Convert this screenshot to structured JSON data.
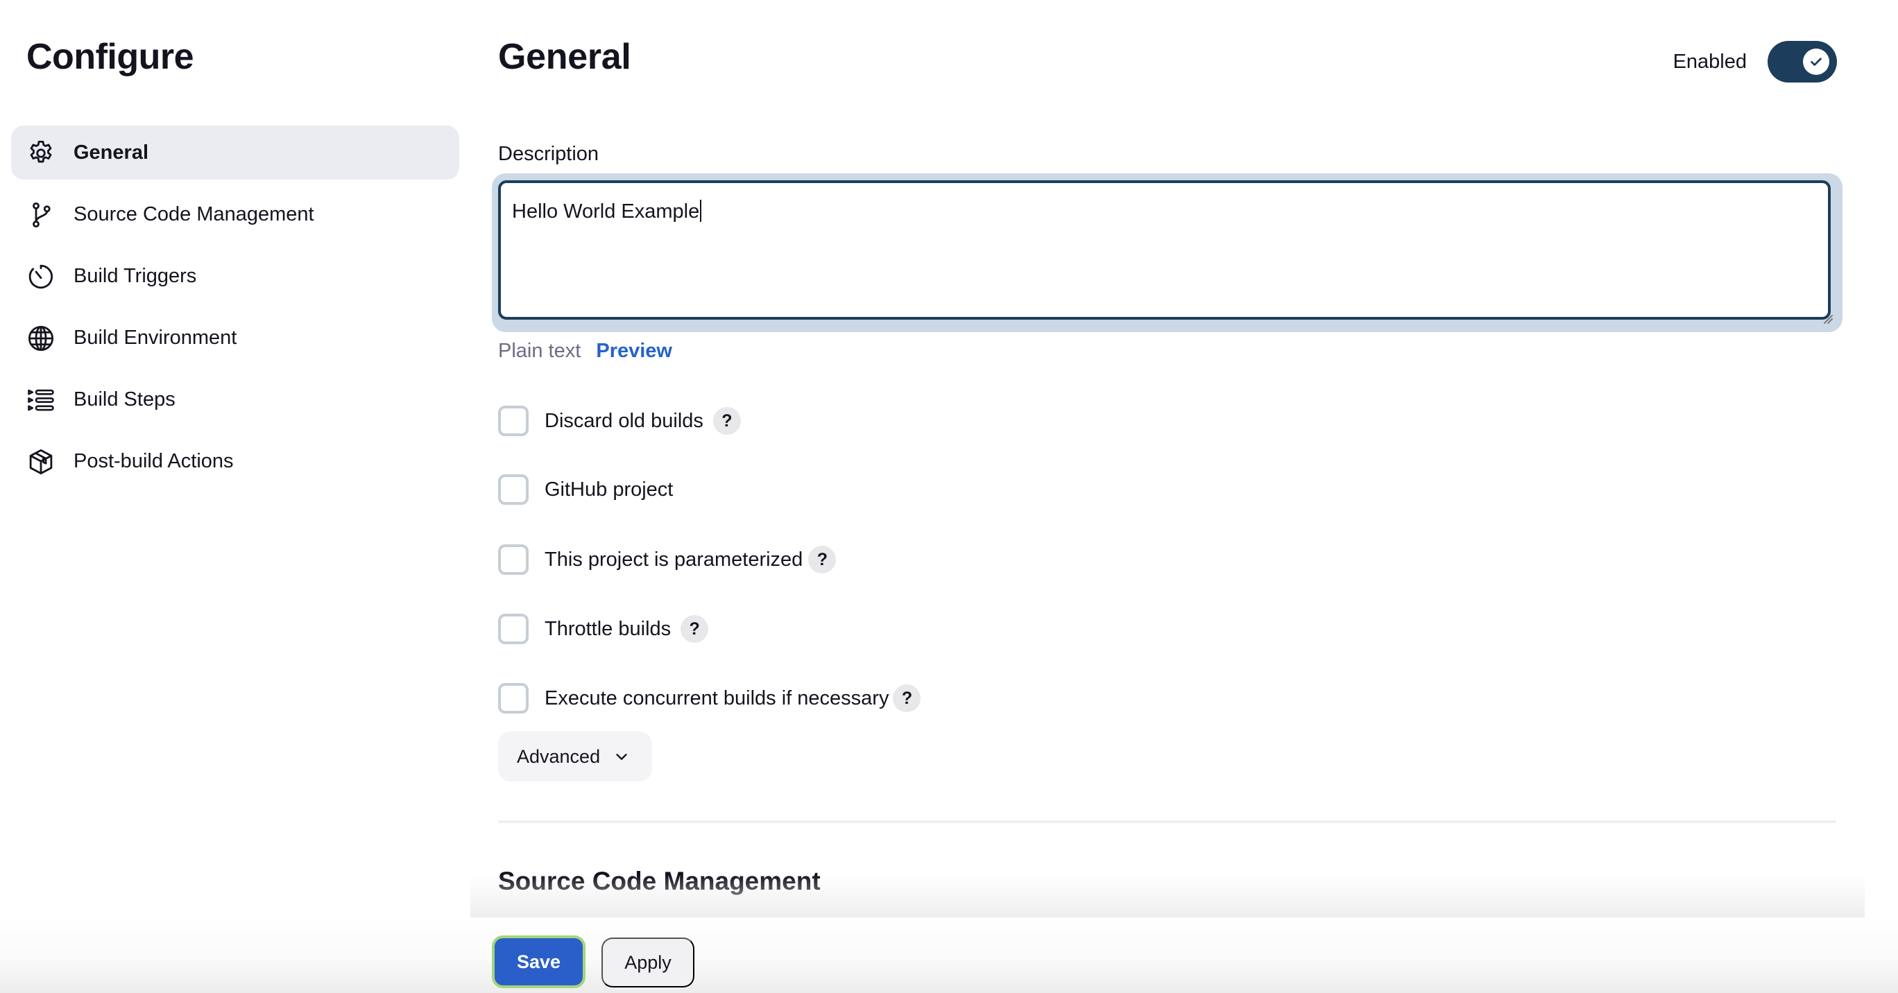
{
  "sidebar": {
    "title": "Configure",
    "items": [
      {
        "label": "General",
        "icon": "gear-icon",
        "active": true
      },
      {
        "label": "Source Code Management",
        "icon": "git-branch-icon",
        "active": false
      },
      {
        "label": "Build Triggers",
        "icon": "timer-icon",
        "active": false
      },
      {
        "label": "Build Environment",
        "icon": "globe-icon",
        "active": false
      },
      {
        "label": "Build Steps",
        "icon": "list-steps-icon",
        "active": false
      },
      {
        "label": "Post-build Actions",
        "icon": "package-icon",
        "active": false
      }
    ]
  },
  "main": {
    "title": "General",
    "enabled": {
      "label": "Enabled",
      "value": true,
      "icon": "checkmark-icon"
    },
    "description": {
      "label": "Description",
      "value": "Hello World Example",
      "format_plain": "Plain text",
      "format_preview": "Preview"
    },
    "options": [
      {
        "label": "Discard old builds",
        "checked": false,
        "help": "?"
      },
      {
        "label": "GitHub project",
        "checked": false
      },
      {
        "label": "This project is parameterized",
        "checked": false,
        "help": "?"
      },
      {
        "label": "Throttle builds",
        "checked": false,
        "help": "?"
      },
      {
        "label": "Execute concurrent builds if necessary",
        "checked": false,
        "help": "?"
      }
    ],
    "advanced_label": "Advanced",
    "next_section_title": "Source Code Management"
  },
  "footer": {
    "save_label": "Save",
    "apply_label": "Apply"
  },
  "colors": {
    "accent": "#2a5fc9",
    "toggle": "#1d3d5c",
    "link": "#2563c9",
    "focus_ring": "#a5d57b"
  }
}
